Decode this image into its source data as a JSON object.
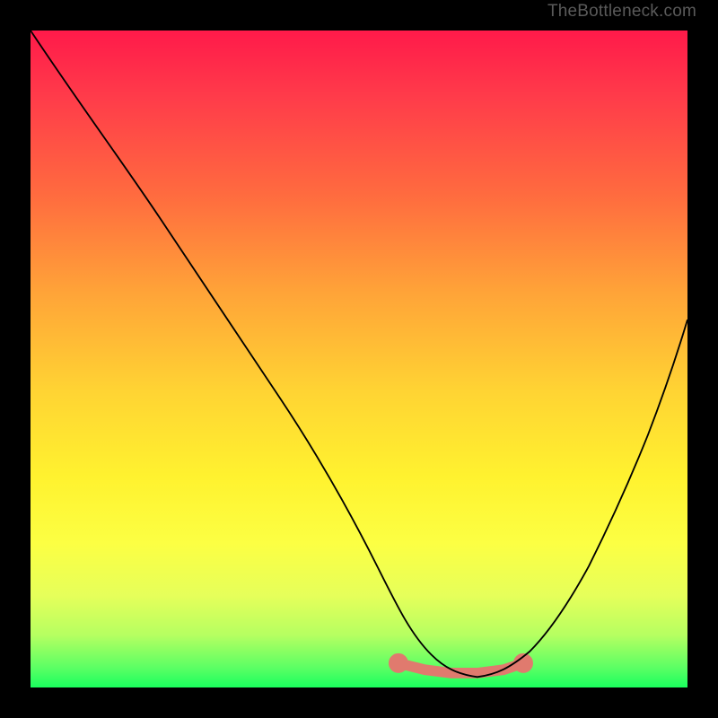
{
  "watermark": {
    "text": "TheBottleneck.com"
  },
  "chart_data": {
    "type": "line",
    "title": "",
    "xlabel": "",
    "ylabel": "",
    "xlim": [
      0,
      100
    ],
    "ylim": [
      0,
      100
    ],
    "series": [
      {
        "name": "curve",
        "x": [
          0,
          5,
          10,
          15,
          20,
          25,
          30,
          35,
          40,
          45,
          50,
          53,
          56,
          59,
          61,
          63,
          65,
          68,
          71,
          74,
          77,
          80,
          83,
          86,
          89,
          92,
          95,
          97,
          99,
          100
        ],
        "values": [
          100,
          94,
          87,
          79,
          71,
          63,
          55,
          47,
          39,
          31,
          23,
          17,
          12,
          8,
          5,
          3,
          2,
          1.5,
          2,
          3,
          5,
          8,
          12,
          17,
          23,
          30,
          38,
          45,
          52,
          56
        ]
      }
    ],
    "markers": {
      "name": "highlight-band",
      "color": "#e07a6e",
      "points": [
        {
          "x": 56,
          "y": 3.5
        },
        {
          "x": 60,
          "y": 2.5
        },
        {
          "x": 64,
          "y": 2.0
        },
        {
          "x": 68,
          "y": 2.0
        },
        {
          "x": 72,
          "y": 2.5
        },
        {
          "x": 75,
          "y": 3.5
        }
      ]
    },
    "background": {
      "type": "vertical-gradient",
      "stops": [
        {
          "pos": 0.0,
          "color": "#ff1a4a"
        },
        {
          "pos": 0.25,
          "color": "#ff6b3f"
        },
        {
          "pos": 0.55,
          "color": "#ffd433"
        },
        {
          "pos": 0.78,
          "color": "#fcff43"
        },
        {
          "pos": 0.92,
          "color": "#b6ff61"
        },
        {
          "pos": 1.0,
          "color": "#1aff5e"
        }
      ]
    }
  }
}
